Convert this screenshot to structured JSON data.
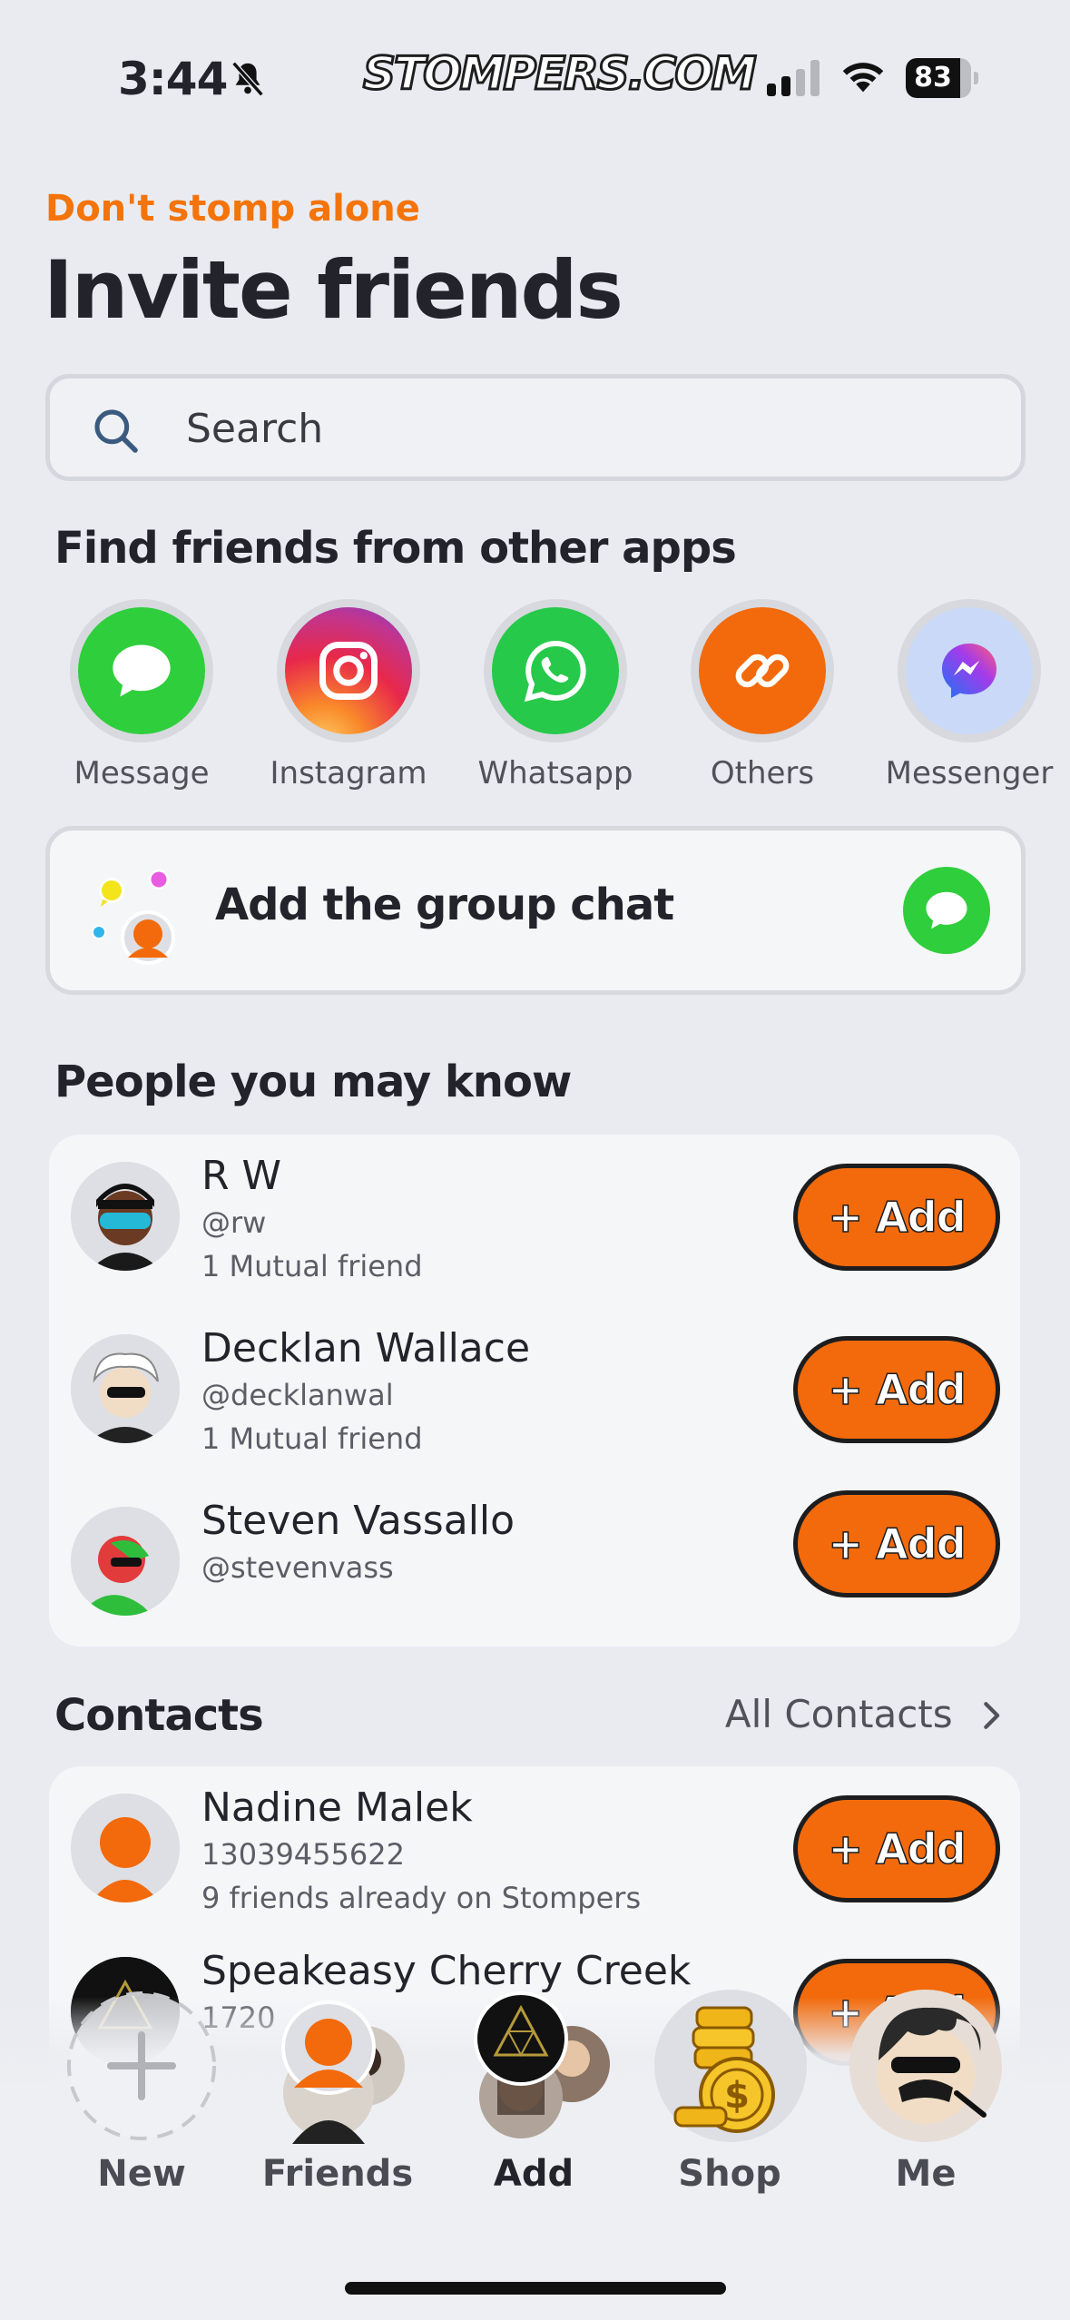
{
  "status_bar": {
    "time": "3:44",
    "brand": "STOMPERS.COM",
    "battery": "83",
    "battery_level": 0.83
  },
  "header": {
    "kicker": "Don't stomp alone",
    "title": "Invite friends"
  },
  "search": {
    "placeholder": "Search"
  },
  "apps_section": {
    "title": "Find friends from other apps",
    "apps": [
      {
        "label": "Message",
        "icon": "message-bubble-icon",
        "color": "#2fce3c"
      },
      {
        "label": "Instagram",
        "icon": "instagram-icon",
        "color": "#e1306c"
      },
      {
        "label": "Whatsapp",
        "icon": "whatsapp-icon",
        "color": "#27c94a"
      },
      {
        "label": "Others",
        "icon": "link-icon",
        "color": "#f26a0b"
      },
      {
        "label": "Messenger",
        "icon": "messenger-icon",
        "color": "#c9d9f7"
      }
    ]
  },
  "group_chat": {
    "label": "Add the group chat"
  },
  "people_section": {
    "title": "People you may know",
    "people": [
      {
        "name": "R W",
        "handle": "@rw",
        "mutual": "1 Mutual friend"
      },
      {
        "name": "Decklan Wallace",
        "handle": "@decklanwal",
        "mutual": "1 Mutual friend"
      },
      {
        "name": "Steven Vassallo",
        "handle": "@stevenvass",
        "mutual": ""
      }
    ],
    "add_label": "+ Add"
  },
  "contacts_section": {
    "title": "Contacts",
    "all_label": "All Contacts",
    "contacts": [
      {
        "name": "Nadine Malek",
        "phone": "13039455622",
        "note": "9 friends already on Stompers"
      },
      {
        "name": "Speakeasy Cherry Creek",
        "phone": "1720",
        "note": ""
      }
    ]
  },
  "bottom_nav": {
    "items": [
      {
        "label": "New",
        "icon": "plus-icon"
      },
      {
        "label": "Friends",
        "icon": "friends-avatars-icon"
      },
      {
        "label": "Add",
        "icon": "add-avatars-icon"
      },
      {
        "label": "Shop",
        "icon": "coins-icon"
      },
      {
        "label": "Me",
        "icon": "profile-avatar-icon"
      }
    ]
  },
  "colors": {
    "accent": "#f26a0b",
    "background": "#e9ebf1",
    "card": "#f5f6f8"
  }
}
